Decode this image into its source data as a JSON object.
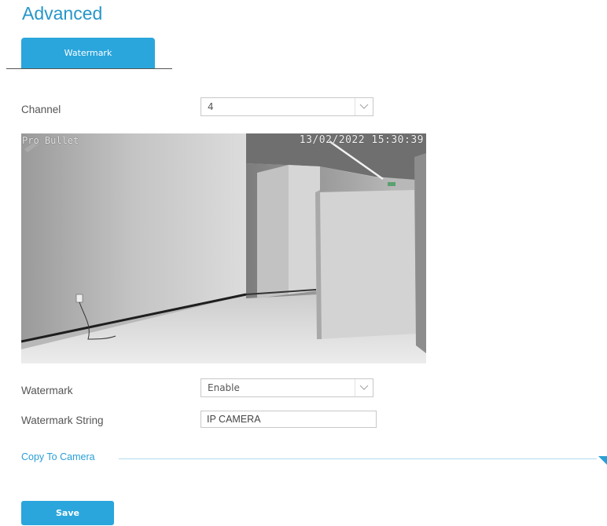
{
  "page": {
    "title": "Advanced"
  },
  "tabs": [
    {
      "label": "Watermark",
      "active": true
    }
  ],
  "form": {
    "channel": {
      "label": "Channel",
      "value": "4"
    },
    "preview": {
      "osd_name": "Pro Bullet",
      "osd_time": "13/02/2022 15:30:39"
    },
    "watermark": {
      "label": "Watermark",
      "value": "Enable"
    },
    "watermark_string": {
      "label": "Watermark String",
      "value": "IP CAMERA"
    }
  },
  "copy_to_camera": {
    "label": "Copy To Camera"
  },
  "buttons": {
    "save": "Save"
  },
  "colors": {
    "accent": "#2aa6dc",
    "title": "#2696c9"
  }
}
